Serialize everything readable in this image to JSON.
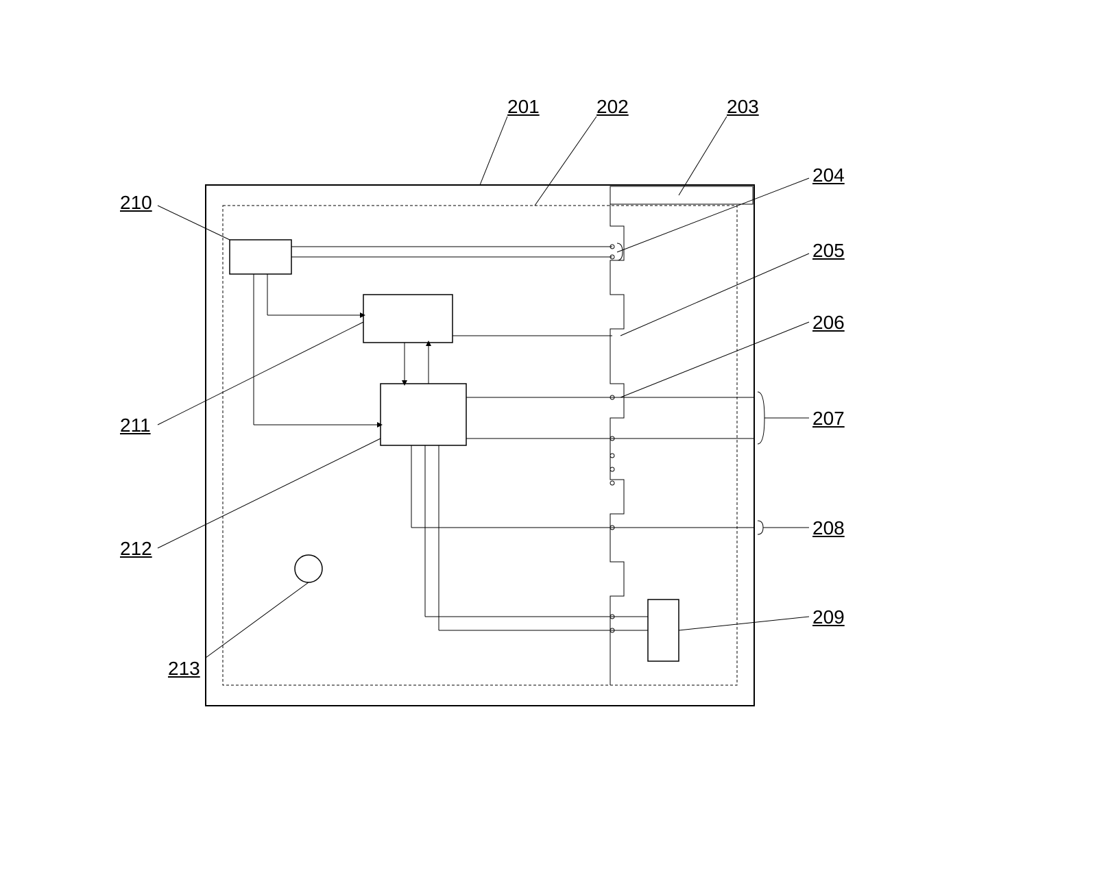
{
  "labels": {
    "l201": "201",
    "l202": "202",
    "l203": "203",
    "l204": "204",
    "l205": "205",
    "l206": "206",
    "l207": "207",
    "l208": "208",
    "l209": "209",
    "l210": "210",
    "l211": "211",
    "l212": "212",
    "l213": "213"
  }
}
